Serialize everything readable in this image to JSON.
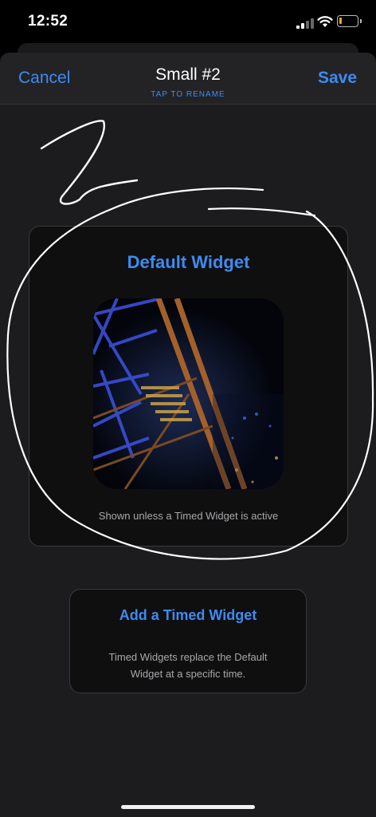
{
  "status_bar": {
    "time": "12:52",
    "battery_level": 0.15,
    "battery_color": "#f5a623",
    "icons": [
      "cellular-signal-icon",
      "wifi-icon",
      "battery-icon"
    ]
  },
  "nav": {
    "cancel_label": "Cancel",
    "title": "Small #2",
    "subtitle": "TAP TO RENAME",
    "save_label": "Save",
    "accent_color": "#3d8bf2"
  },
  "default_widget": {
    "title": "Default Widget",
    "caption": "Shown unless a Timed Widget is active"
  },
  "timed_widget": {
    "title": "Add a Timed Widget",
    "caption_line1": "Timed Widgets replace the Default",
    "caption_line2": "Widget at a specific time."
  }
}
